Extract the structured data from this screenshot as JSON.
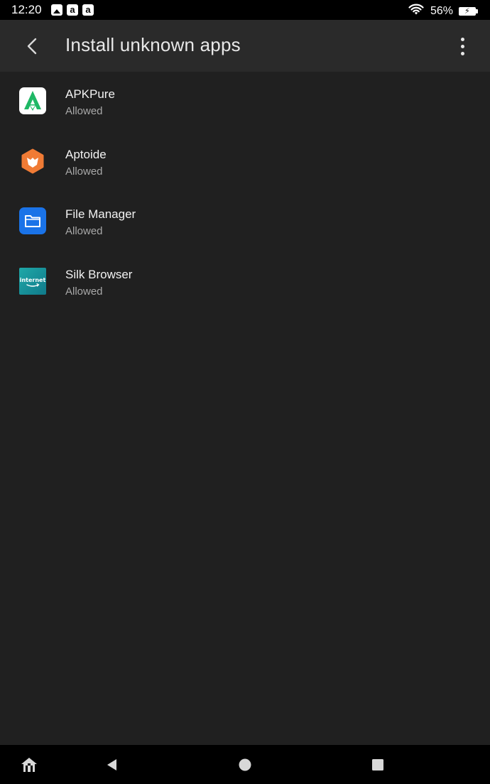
{
  "status_bar": {
    "time": "12:20",
    "battery_percent": "56%",
    "notification_icons": [
      "image-icon",
      "amazon-icon",
      "amazon-icon"
    ],
    "amazon_glyph": "a"
  },
  "app_bar": {
    "title": "Install unknown apps"
  },
  "apps": [
    {
      "name": "APKPure",
      "status": "Allowed",
      "icon": "apkpure-icon"
    },
    {
      "name": "Aptoide",
      "status": "Allowed",
      "icon": "aptoide-icon"
    },
    {
      "name": "File Manager",
      "status": "Allowed",
      "icon": "file-manager-icon"
    },
    {
      "name": "Silk Browser",
      "status": "Allowed",
      "icon": "silk-browser-icon",
      "icon_text": "internet"
    }
  ],
  "nav_bar": {
    "buttons": [
      "home-shortcut-icon",
      "back-icon",
      "home-icon",
      "recents-icon"
    ]
  },
  "colors": {
    "background": "#202020",
    "app_bar": "#2a2a2a",
    "apkpure_green": "#1fb865",
    "aptoide_orange": "#f07b35",
    "file_manager_blue": "#1a73e8",
    "silk_teal": "#1a9a9a"
  }
}
